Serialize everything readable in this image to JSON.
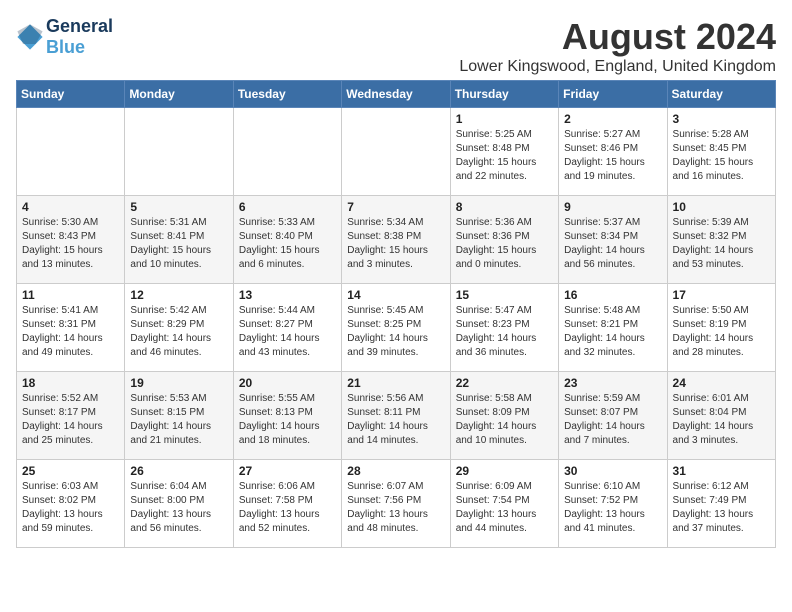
{
  "header": {
    "logo_line1": "General",
    "logo_line2": "Blue",
    "month_year": "August 2024",
    "location": "Lower Kingswood, England, United Kingdom"
  },
  "days_of_week": [
    "Sunday",
    "Monday",
    "Tuesday",
    "Wednesday",
    "Thursday",
    "Friday",
    "Saturday"
  ],
  "weeks": [
    [
      {
        "day": "",
        "content": ""
      },
      {
        "day": "",
        "content": ""
      },
      {
        "day": "",
        "content": ""
      },
      {
        "day": "",
        "content": ""
      },
      {
        "day": "1",
        "content": "Sunrise: 5:25 AM\nSunset: 8:48 PM\nDaylight: 15 hours\nand 22 minutes."
      },
      {
        "day": "2",
        "content": "Sunrise: 5:27 AM\nSunset: 8:46 PM\nDaylight: 15 hours\nand 19 minutes."
      },
      {
        "day": "3",
        "content": "Sunrise: 5:28 AM\nSunset: 8:45 PM\nDaylight: 15 hours\nand 16 minutes."
      }
    ],
    [
      {
        "day": "4",
        "content": "Sunrise: 5:30 AM\nSunset: 8:43 PM\nDaylight: 15 hours\nand 13 minutes."
      },
      {
        "day": "5",
        "content": "Sunrise: 5:31 AM\nSunset: 8:41 PM\nDaylight: 15 hours\nand 10 minutes."
      },
      {
        "day": "6",
        "content": "Sunrise: 5:33 AM\nSunset: 8:40 PM\nDaylight: 15 hours\nand 6 minutes."
      },
      {
        "day": "7",
        "content": "Sunrise: 5:34 AM\nSunset: 8:38 PM\nDaylight: 15 hours\nand 3 minutes."
      },
      {
        "day": "8",
        "content": "Sunrise: 5:36 AM\nSunset: 8:36 PM\nDaylight: 15 hours\nand 0 minutes."
      },
      {
        "day": "9",
        "content": "Sunrise: 5:37 AM\nSunset: 8:34 PM\nDaylight: 14 hours\nand 56 minutes."
      },
      {
        "day": "10",
        "content": "Sunrise: 5:39 AM\nSunset: 8:32 PM\nDaylight: 14 hours\nand 53 minutes."
      }
    ],
    [
      {
        "day": "11",
        "content": "Sunrise: 5:41 AM\nSunset: 8:31 PM\nDaylight: 14 hours\nand 49 minutes."
      },
      {
        "day": "12",
        "content": "Sunrise: 5:42 AM\nSunset: 8:29 PM\nDaylight: 14 hours\nand 46 minutes."
      },
      {
        "day": "13",
        "content": "Sunrise: 5:44 AM\nSunset: 8:27 PM\nDaylight: 14 hours\nand 43 minutes."
      },
      {
        "day": "14",
        "content": "Sunrise: 5:45 AM\nSunset: 8:25 PM\nDaylight: 14 hours\nand 39 minutes."
      },
      {
        "day": "15",
        "content": "Sunrise: 5:47 AM\nSunset: 8:23 PM\nDaylight: 14 hours\nand 36 minutes."
      },
      {
        "day": "16",
        "content": "Sunrise: 5:48 AM\nSunset: 8:21 PM\nDaylight: 14 hours\nand 32 minutes."
      },
      {
        "day": "17",
        "content": "Sunrise: 5:50 AM\nSunset: 8:19 PM\nDaylight: 14 hours\nand 28 minutes."
      }
    ],
    [
      {
        "day": "18",
        "content": "Sunrise: 5:52 AM\nSunset: 8:17 PM\nDaylight: 14 hours\nand 25 minutes."
      },
      {
        "day": "19",
        "content": "Sunrise: 5:53 AM\nSunset: 8:15 PM\nDaylight: 14 hours\nand 21 minutes."
      },
      {
        "day": "20",
        "content": "Sunrise: 5:55 AM\nSunset: 8:13 PM\nDaylight: 14 hours\nand 18 minutes."
      },
      {
        "day": "21",
        "content": "Sunrise: 5:56 AM\nSunset: 8:11 PM\nDaylight: 14 hours\nand 14 minutes."
      },
      {
        "day": "22",
        "content": "Sunrise: 5:58 AM\nSunset: 8:09 PM\nDaylight: 14 hours\nand 10 minutes."
      },
      {
        "day": "23",
        "content": "Sunrise: 5:59 AM\nSunset: 8:07 PM\nDaylight: 14 hours\nand 7 minutes."
      },
      {
        "day": "24",
        "content": "Sunrise: 6:01 AM\nSunset: 8:04 PM\nDaylight: 14 hours\nand 3 minutes."
      }
    ],
    [
      {
        "day": "25",
        "content": "Sunrise: 6:03 AM\nSunset: 8:02 PM\nDaylight: 13 hours\nand 59 minutes."
      },
      {
        "day": "26",
        "content": "Sunrise: 6:04 AM\nSunset: 8:00 PM\nDaylight: 13 hours\nand 56 minutes."
      },
      {
        "day": "27",
        "content": "Sunrise: 6:06 AM\nSunset: 7:58 PM\nDaylight: 13 hours\nand 52 minutes."
      },
      {
        "day": "28",
        "content": "Sunrise: 6:07 AM\nSunset: 7:56 PM\nDaylight: 13 hours\nand 48 minutes."
      },
      {
        "day": "29",
        "content": "Sunrise: 6:09 AM\nSunset: 7:54 PM\nDaylight: 13 hours\nand 44 minutes."
      },
      {
        "day": "30",
        "content": "Sunrise: 6:10 AM\nSunset: 7:52 PM\nDaylight: 13 hours\nand 41 minutes."
      },
      {
        "day": "31",
        "content": "Sunrise: 6:12 AM\nSunset: 7:49 PM\nDaylight: 13 hours\nand 37 minutes."
      }
    ]
  ]
}
